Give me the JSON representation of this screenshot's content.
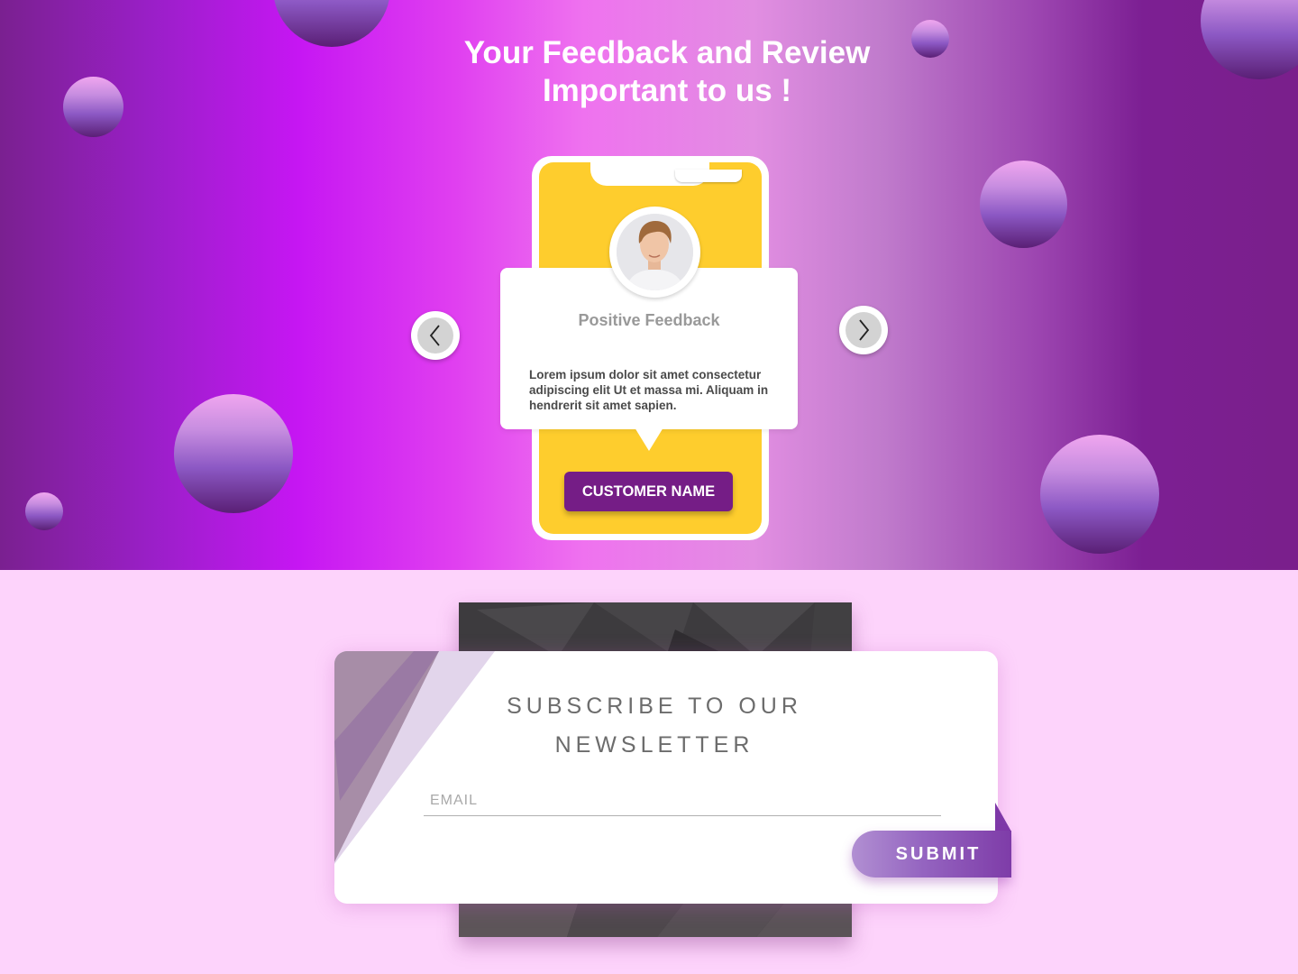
{
  "hero": {
    "title_line1": "Your Feedback and Review",
    "title_line2": "Important to us !",
    "colors": {
      "gradient_start": "#7a2090",
      "gradient_peak": "#c616f3",
      "gradient_light": "#e28ee2",
      "gradient_end": "#7a1f8b"
    }
  },
  "testimonial": {
    "heading": "Positive Feedback",
    "text": "Lorem ipsum dolor sit amet consectetur adipiscing elit Ut et massa mi. Aliquam in hendrerit sit amet sapien.",
    "customer_button": "CUSTOMER NAME",
    "avatar_icon": "person-avatar-icon",
    "colors": {
      "phone_screen": "#fecd2d",
      "name_button": "#751d86"
    }
  },
  "carousel": {
    "prev_icon": "chevron-left-icon",
    "next_icon": "chevron-right-icon"
  },
  "newsletter": {
    "title_line1": "SUBSCRIBE TO OUR",
    "title_line2": "NEWSLETTER",
    "email_placeholder": "EMAIL",
    "submit_label": "SUBMIT",
    "colors": {
      "background": "#fdd3fb",
      "submit_start": "#b18fd2",
      "submit_end": "#7e3ca8"
    }
  }
}
